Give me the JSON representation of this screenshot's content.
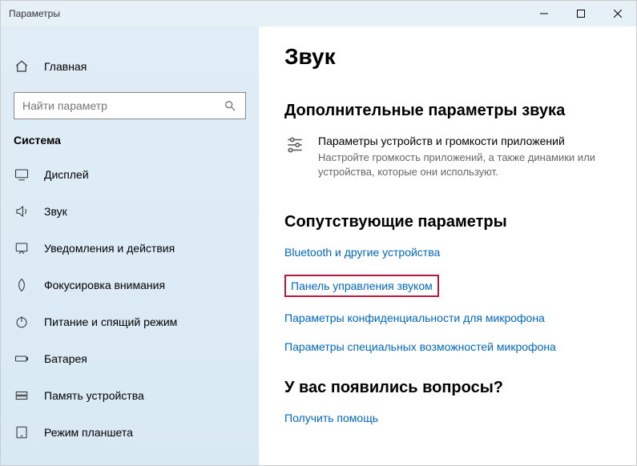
{
  "window": {
    "title": "Параметры"
  },
  "sidebar": {
    "home_label": "Главная",
    "search_placeholder": "Найти параметр",
    "group_label": "Система",
    "items": [
      {
        "label": "Дисплей"
      },
      {
        "label": "Звук"
      },
      {
        "label": "Уведомления и действия"
      },
      {
        "label": "Фокусировка внимания"
      },
      {
        "label": "Питание и спящий режим"
      },
      {
        "label": "Батарея"
      },
      {
        "label": "Память устройства"
      },
      {
        "label": "Режим планшета"
      }
    ]
  },
  "content": {
    "page_title": "Звук",
    "section1": {
      "heading": "Дополнительные параметры звука",
      "item_title": "Параметры устройств и громкости приложений",
      "item_desc": "Настройте громкость приложений, а также динамики или устройства, которые они используют."
    },
    "section2": {
      "heading": "Сопутствующие параметры",
      "links": [
        "Bluetooth и другие устройства",
        "Панель управления звуком",
        "Параметры конфиденциальности для микрофона",
        "Параметры специальных возможностей микрофона"
      ]
    },
    "section3": {
      "heading": "У вас появились вопросы?",
      "link": "Получить помощь"
    }
  }
}
